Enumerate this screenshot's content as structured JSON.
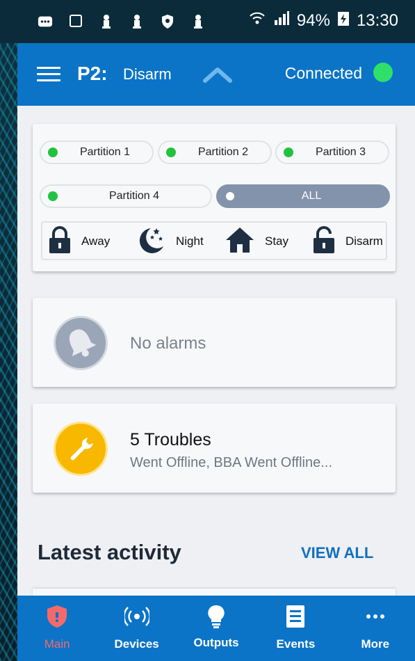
{
  "status_bar": {
    "battery": "94%",
    "time": "13:30"
  },
  "app_bar": {
    "partition": "P2:",
    "state": "Disarm",
    "connection": "Connected",
    "connection_color": "#2ee06a"
  },
  "partitions": [
    {
      "label": "Partition 1"
    },
    {
      "label": "Partition 2"
    },
    {
      "label": "Partition 3"
    },
    {
      "label": "Partition 4"
    },
    {
      "label": "ALL"
    }
  ],
  "modes": [
    {
      "label": "Away",
      "icon": "lock-icon"
    },
    {
      "label": "Night",
      "icon": "moon-stars-icon"
    },
    {
      "label": "Stay",
      "icon": "home-icon"
    },
    {
      "label": "Disarm",
      "icon": "unlock-icon"
    }
  ],
  "alarms": {
    "text": "No alarms",
    "icon": "bell-icon"
  },
  "troubles": {
    "title": "5 Troubles",
    "detail": "Went Offline, BBA Went Offline...",
    "icon": "wrench-icon"
  },
  "activity": {
    "heading": "Latest activity",
    "view_all": "VIEW ALL"
  },
  "bottom_nav": [
    {
      "label": "Main",
      "icon": "shield-icon"
    },
    {
      "label": "Devices",
      "icon": "devices-icon"
    },
    {
      "label": "Outputs",
      "icon": "bulb-icon"
    },
    {
      "label": "Events",
      "icon": "list-icon"
    },
    {
      "label": "More",
      "icon": "more-icon"
    }
  ],
  "colors": {
    "primary": "#0b74c7",
    "active_nav": "#f46a6a",
    "partition_ok": "#21c33e",
    "trouble": "#f8b800"
  }
}
